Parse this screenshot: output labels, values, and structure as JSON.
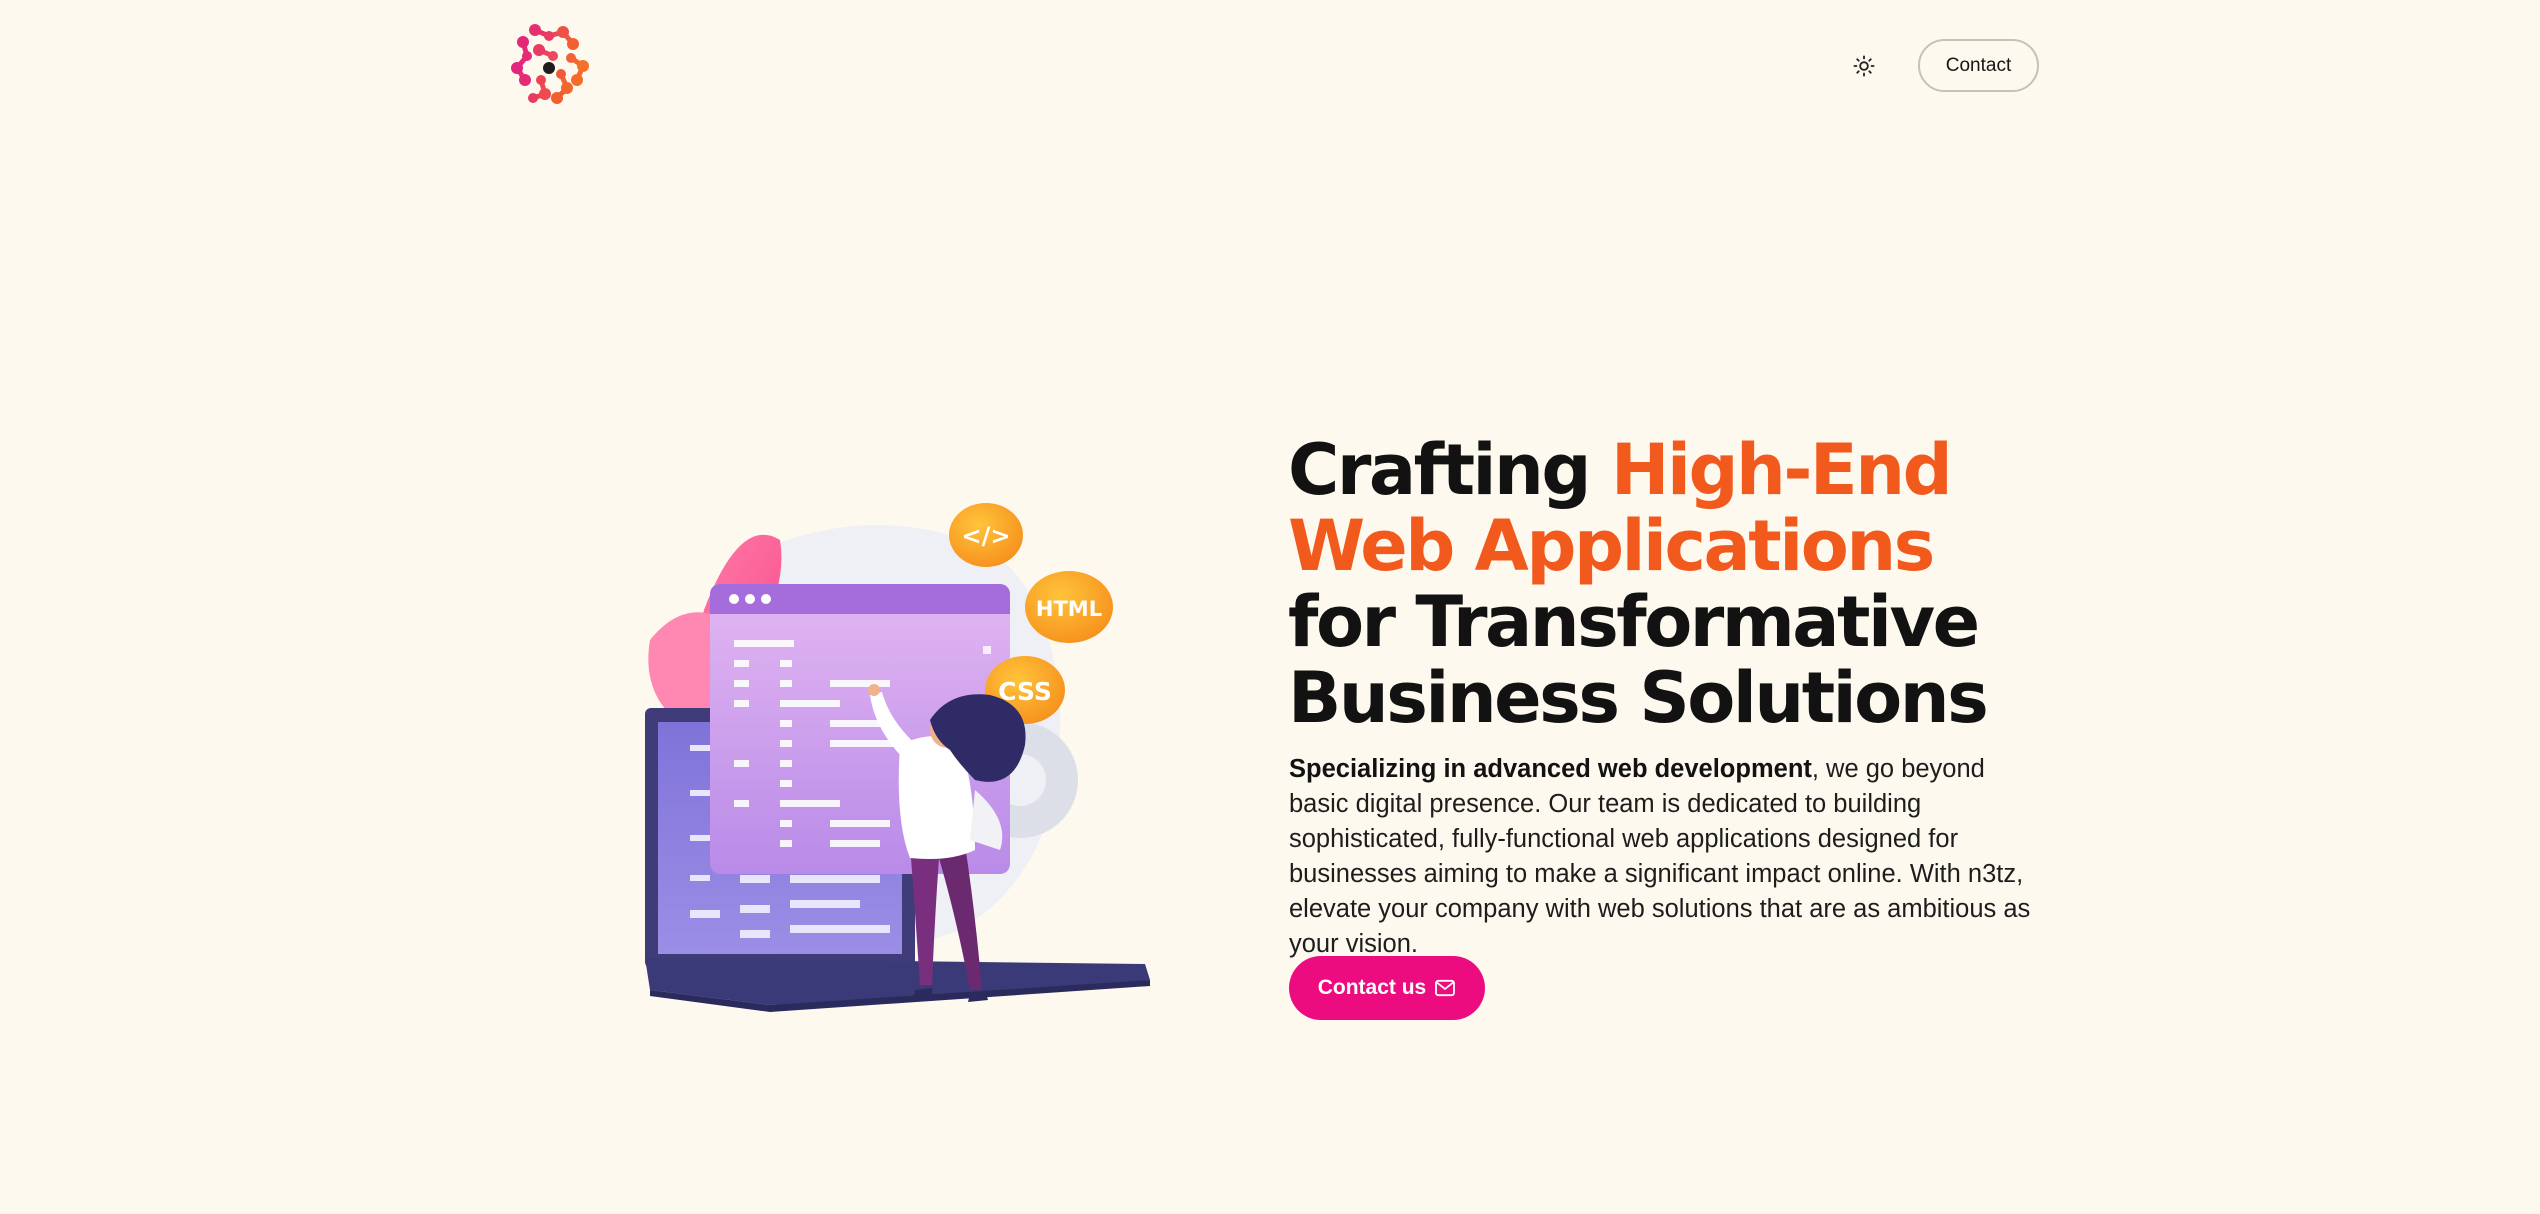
{
  "header": {
    "logo_icon": "n3tz-dots-logo",
    "theme_toggle_icon": "sun-icon",
    "contact_label": "Contact"
  },
  "hero": {
    "headline_part1": "Crafting ",
    "headline_accent": "High-End Web Applications",
    "headline_part2": " for Transformative Business Solutions",
    "lead_bold": "Specializing in advanced web development",
    "lead_rest": ", we go beyond basic digital presence. Our team is dedicated to building sophisticated, fully-functional web applications designed for businesses aiming to make a significant impact online. With n3tz, elevate your company with web solutions that are as ambitious as your vision.",
    "cta_label": "Contact us",
    "cta_icon": "mail-icon",
    "illustration_badges": [
      "</>",
      "HTML",
      "CSS"
    ]
  },
  "colors": {
    "background": "#fef9ee",
    "accent_orange": "#f25a1d",
    "cta_pink": "#ec0c7f",
    "text": "#121212"
  }
}
